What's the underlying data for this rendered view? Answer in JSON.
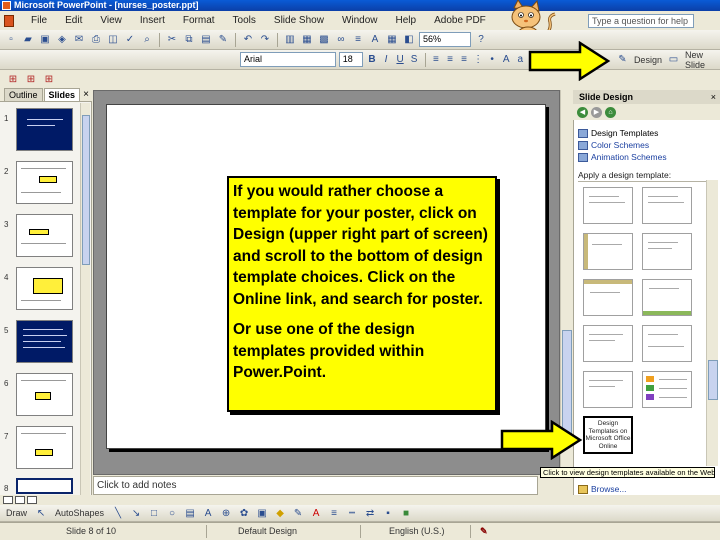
{
  "window": {
    "title": "Microsoft PowerPoint - [nurses_poster.ppt]"
  },
  "menu": {
    "items": [
      "File",
      "Edit",
      "View",
      "Insert",
      "Format",
      "Tools",
      "Slide Show",
      "Window",
      "Help",
      "Adobe PDF"
    ],
    "help_placeholder": "Type a question for help"
  },
  "toolbar": {
    "zoom": "56%",
    "font_name": "Arial",
    "font_size": "18",
    "bold": "B",
    "italic": "I",
    "underline": "U",
    "shadow": "S",
    "design_label": "Design",
    "new_slide_label": "New Slide"
  },
  "left_pane": {
    "tabs": [
      "Outline",
      "Slides"
    ],
    "close": "×",
    "slide_numbers": [
      "1",
      "2",
      "3",
      "4",
      "5",
      "6",
      "7",
      "8"
    ]
  },
  "slide": {
    "paragraph1": "If you would rather choose a template for your poster, click on Design (upper right part of screen) and scroll to the bottom of design template choices.  Click on the Online link, and search for poster.",
    "paragraph2": "Or use one of the design templates provided within Power.Point."
  },
  "notes_placeholder": "Click to add notes",
  "task_pane": {
    "title": "Slide Design",
    "close": "×",
    "links": [
      "Design Templates",
      "Color Schemes",
      "Animation Schemes"
    ],
    "section_label": "Apply a design template:",
    "office_online": "Design Templates on Microsoft Office Online",
    "tooltip": "Click to view design templates available on the Web",
    "browse": "Browse..."
  },
  "draw_toolbar": {
    "draw_label": "Draw",
    "autoshapes_label": "AutoShapes"
  },
  "status": {
    "slide": "Slide 8 of 10",
    "design": "Default Design",
    "language": "English (U.S.)"
  },
  "colors": {
    "callout_fill": "#ffff00",
    "arrow_fill": "#ffff00",
    "title_bar": "#0a5bd6"
  }
}
